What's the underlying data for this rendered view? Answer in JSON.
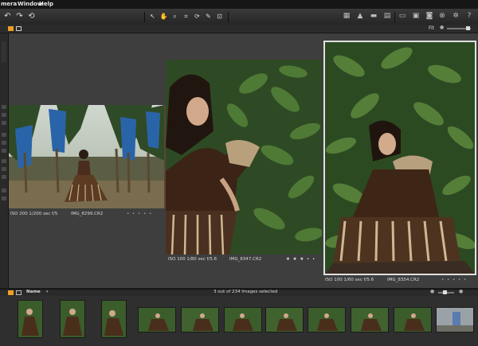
{
  "menu": {
    "items": [
      "mera",
      "Window",
      "Help"
    ]
  },
  "toolbar": {
    "left_icons": [
      "undo-icon",
      "redo-icon",
      "rotate-icon"
    ],
    "center_tools": [
      "select-icon",
      "hand-icon",
      "zoom-icon",
      "crop-icon",
      "straighten-icon",
      "color-picker-icon",
      "spot-icon"
    ],
    "right_icons": [
      "grid-icon",
      "warning-icon",
      "import-icon",
      "album-icon",
      "export-icon",
      "folder-icon",
      "print-icon",
      "camera-icon",
      "lens-icon",
      "settings-icon",
      "help-icon"
    ]
  },
  "viewbar": {
    "fit_label": "Fit"
  },
  "viewer": {
    "images": [
      {
        "caption": "ISO 200  1/200 sec  f/5",
        "filename": "IMG_8299.CR2",
        "stars": "• • • • •"
      },
      {
        "caption": "ISO 100  1/80 sec  f/5.6",
        "filename": "IMG_8347.CR2",
        "stars": "★ ★ ★ • •"
      },
      {
        "caption": "ISO 100  1/60 sec  f/5.6",
        "filename": "IMG_8354.CR2",
        "stars": "• • • • •"
      }
    ]
  },
  "filmstrip": {
    "sort_label": "Name",
    "status": "3 out of 234 Images selected",
    "thumbs": 12
  },
  "colors": {
    "accent": "#f0a020",
    "selected_border": "#e0e0e0",
    "background": "#3e3e3e"
  }
}
